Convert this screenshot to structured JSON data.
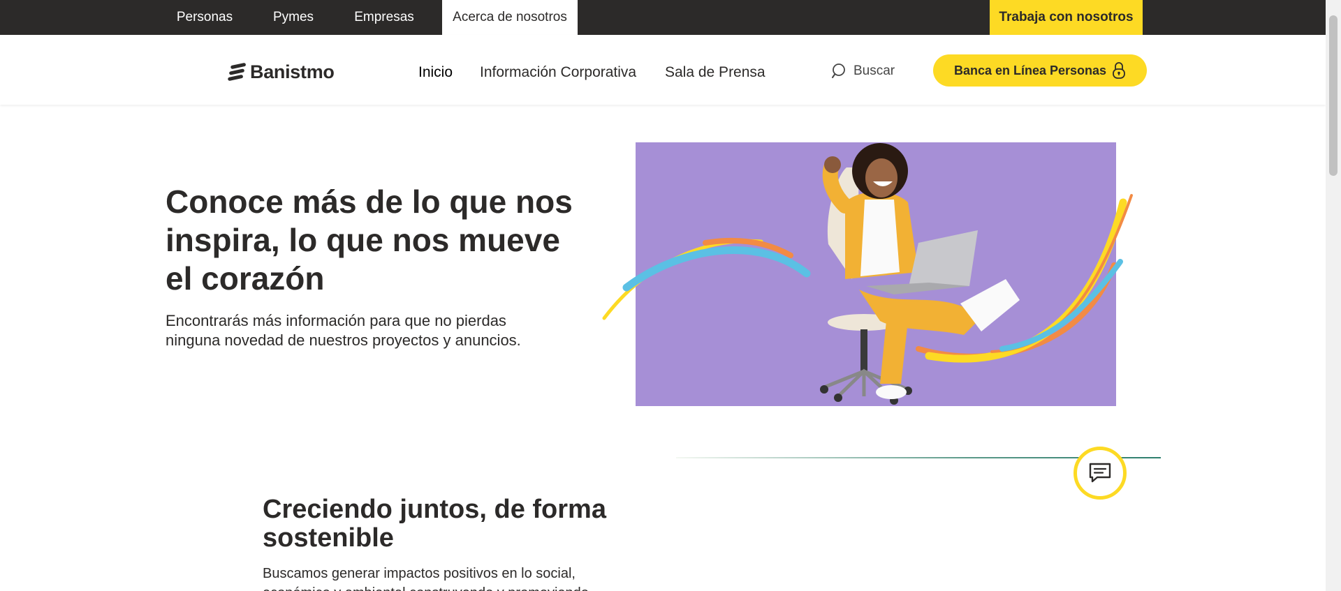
{
  "topbar": {
    "segments": [
      "Personas",
      "Pymes",
      "Empresas",
      "Acerca de nosotros"
    ],
    "work_label": "Trabaja con nosotros"
  },
  "header": {
    "logo_text": "Banistmo",
    "nav": [
      "Inicio",
      "Información Corporativa",
      "Sala de Prensa"
    ],
    "search_label": "Buscar",
    "online_banking_label": "Banca en Línea Personas"
  },
  "hero": {
    "title": "Conoce más de lo que nos inspira, lo que nos mueve el corazón",
    "subtitle": "Encontrarás más información para que no pierdas ninguna novedad de nuestros proyectos y anuncios."
  },
  "section": {
    "title": "Creciendo juntos, de forma sostenible",
    "text": "Buscamos generar impactos positivos en lo social, económico y ambiental construyendo y promoviendo"
  },
  "colors": {
    "brand_yellow": "#fdda24",
    "dark": "#2c2a29",
    "hero_bg": "#a68fd6"
  }
}
